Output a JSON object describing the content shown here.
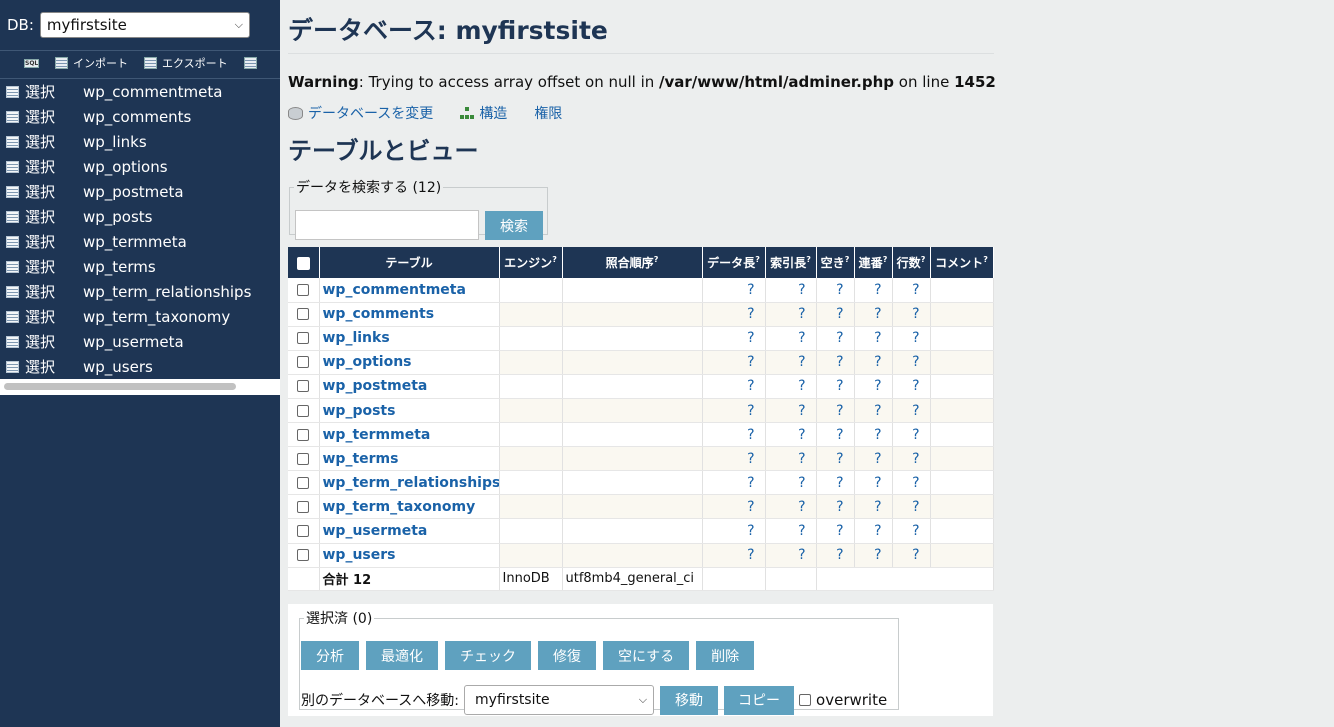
{
  "sidebar": {
    "db_label": "DB:",
    "db_selected": "myfirstsite",
    "tools": [
      {
        "icon": "sql-icon",
        "label": ""
      },
      {
        "icon": "import-icon",
        "label": "インポート"
      },
      {
        "icon": "export-icon",
        "label": "エクスポート"
      },
      {
        "icon": "create-table-icon",
        "label": ""
      }
    ],
    "tables": [
      {
        "select": "選択",
        "name": "wp_commentmeta"
      },
      {
        "select": "選択",
        "name": "wp_comments"
      },
      {
        "select": "選択",
        "name": "wp_links"
      },
      {
        "select": "選択",
        "name": "wp_options"
      },
      {
        "select": "選択",
        "name": "wp_postmeta"
      },
      {
        "select": "選択",
        "name": "wp_posts"
      },
      {
        "select": "選択",
        "name": "wp_termmeta"
      },
      {
        "select": "選択",
        "name": "wp_terms"
      },
      {
        "select": "選択",
        "name": "wp_term_relationships"
      },
      {
        "select": "選択",
        "name": "wp_term_taxonomy"
      },
      {
        "select": "選択",
        "name": "wp_usermeta"
      },
      {
        "select": "選択",
        "name": "wp_users"
      }
    ]
  },
  "main": {
    "title": "データベース: myfirstsite",
    "warning": {
      "label": "Warning",
      "text1": ": Trying to access array offset on null in ",
      "file": "/var/www/html/adminer.php",
      "text2": " on line ",
      "line": "1452"
    },
    "links": {
      "alter_db": "データベースを変更",
      "structure": "構造",
      "privileges": "権限"
    },
    "section_title": "テーブルとビュー",
    "search": {
      "legend": "データを検索する (12)",
      "value": "",
      "button": "検索"
    },
    "table": {
      "headers": {
        "table": "テーブル",
        "engine": "エンジン",
        "collation": "照合順序",
        "data_length": "データ長",
        "index_length": "索引長",
        "data_free": "空き",
        "auto_increment": "連番",
        "rows": "行数",
        "comment": "コメント",
        "help": "?"
      },
      "rows": [
        {
          "name": "wp_commentmeta",
          "data": "?",
          "index": "?",
          "free": "?",
          "ai": "?",
          "rows": "?"
        },
        {
          "name": "wp_comments",
          "data": "?",
          "index": "?",
          "free": "?",
          "ai": "?",
          "rows": "?"
        },
        {
          "name": "wp_links",
          "data": "?",
          "index": "?",
          "free": "?",
          "ai": "?",
          "rows": "?"
        },
        {
          "name": "wp_options",
          "data": "?",
          "index": "?",
          "free": "?",
          "ai": "?",
          "rows": "?"
        },
        {
          "name": "wp_postmeta",
          "data": "?",
          "index": "?",
          "free": "?",
          "ai": "?",
          "rows": "?"
        },
        {
          "name": "wp_posts",
          "data": "?",
          "index": "?",
          "free": "?",
          "ai": "?",
          "rows": "?"
        },
        {
          "name": "wp_termmeta",
          "data": "?",
          "index": "?",
          "free": "?",
          "ai": "?",
          "rows": "?"
        },
        {
          "name": "wp_terms",
          "data": "?",
          "index": "?",
          "free": "?",
          "ai": "?",
          "rows": "?"
        },
        {
          "name": "wp_term_relationships",
          "data": "?",
          "index": "?",
          "free": "?",
          "ai": "?",
          "rows": "?"
        },
        {
          "name": "wp_term_taxonomy",
          "data": "?",
          "index": "?",
          "free": "?",
          "ai": "?",
          "rows": "?"
        },
        {
          "name": "wp_usermeta",
          "data": "?",
          "index": "?",
          "free": "?",
          "ai": "?",
          "rows": "?"
        },
        {
          "name": "wp_users",
          "data": "?",
          "index": "?",
          "free": "?",
          "ai": "?",
          "rows": "?"
        }
      ],
      "total": {
        "label": "合計",
        "count": "12",
        "engine": "InnoDB",
        "collation": "utf8mb4_general_ci"
      }
    },
    "bulk": {
      "legend": "選択済 (0)",
      "buttons": [
        "分析",
        "最適化",
        "チェック",
        "修復",
        "空にする",
        "削除"
      ],
      "move_label": "別のデータベースへ移動:",
      "move_selected": "myfirstsite",
      "move_button": "移動",
      "copy_button": "コピー",
      "overwrite_label": "overwrite"
    }
  },
  "colors": {
    "sidebar_bg": "#1e3554",
    "header_bg": "#1e3554",
    "link": "#1a62a8",
    "button": "#5fa1bf",
    "page_bg": "#eceeee"
  }
}
